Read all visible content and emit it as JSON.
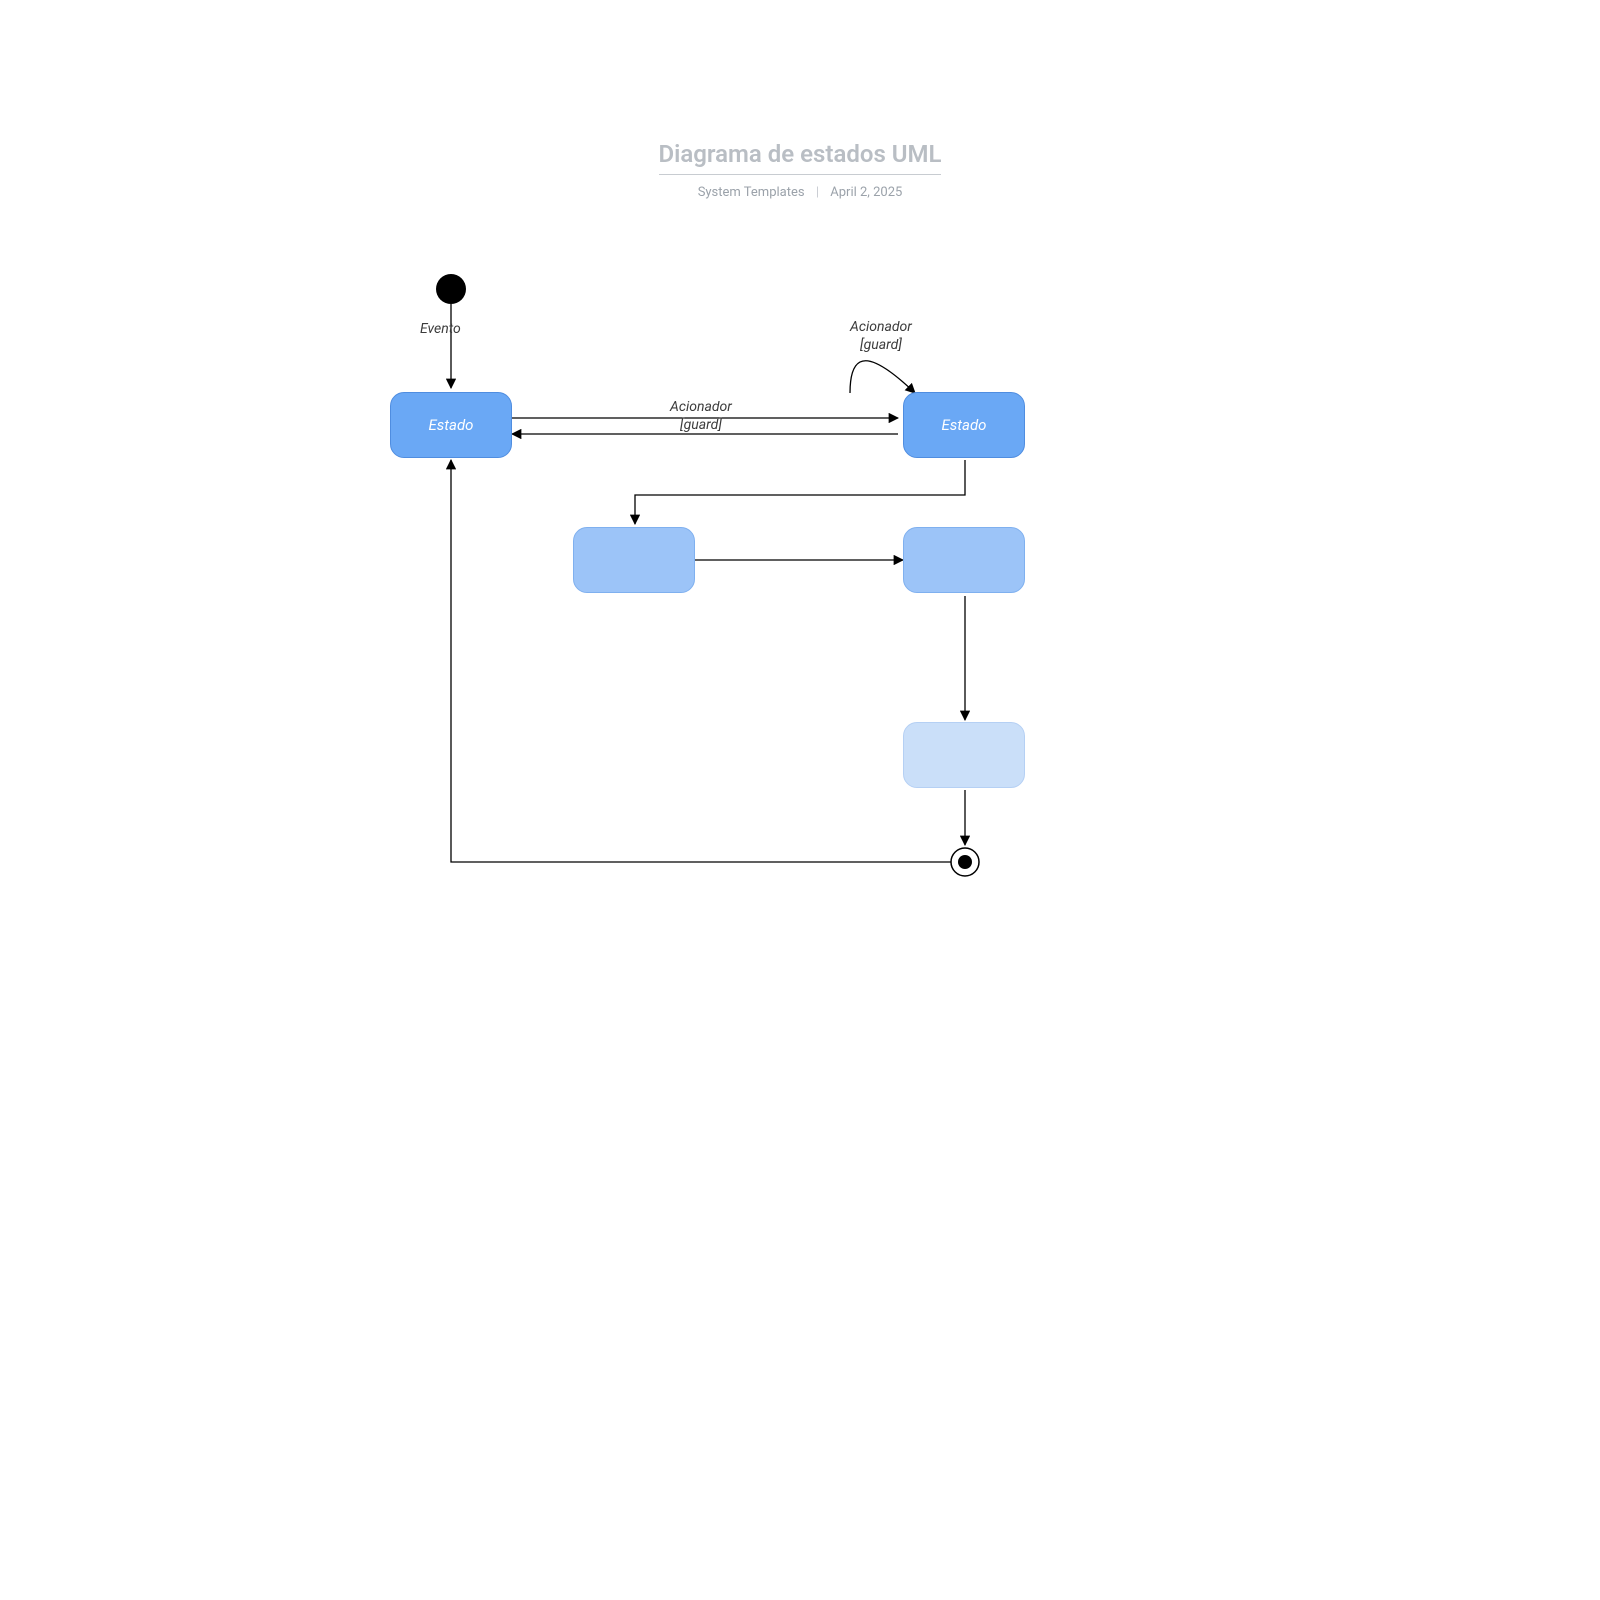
{
  "header": {
    "title": "Diagrama de estados UML",
    "author": "System Templates",
    "date": "April 2, 2025"
  },
  "states": {
    "s1_label": "Estado",
    "s2_label": "Estado"
  },
  "edges": {
    "evento": "Evento",
    "acionador1_line1": "Acionador",
    "acionador1_line2": "[guard]",
    "selfloop_line1": "Acionador",
    "selfloop_line2": "[guard]"
  }
}
